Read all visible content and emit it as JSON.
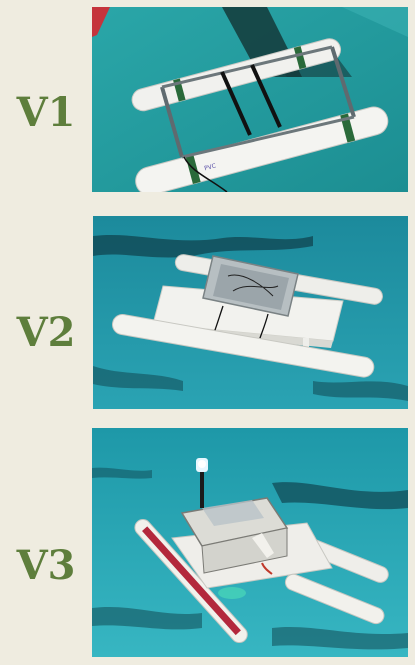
{
  "versions": [
    {
      "label": "V1",
      "photo_icon": "pvc-frame-with-aluminum-rails-photo"
    },
    {
      "label": "V2",
      "photo_icon": "pvc-pontoons-with-white-deck-and-electronics-box-photo"
    },
    {
      "label": "V3",
      "photo_icon": "pvc-pontoons-with-light-mast-and-electronics-box-photo"
    }
  ],
  "colors": {
    "background": "#efece0",
    "label": "#5e7e3c",
    "pool_water": "#1f9fae",
    "pvc_white": "#f2f2ee"
  }
}
